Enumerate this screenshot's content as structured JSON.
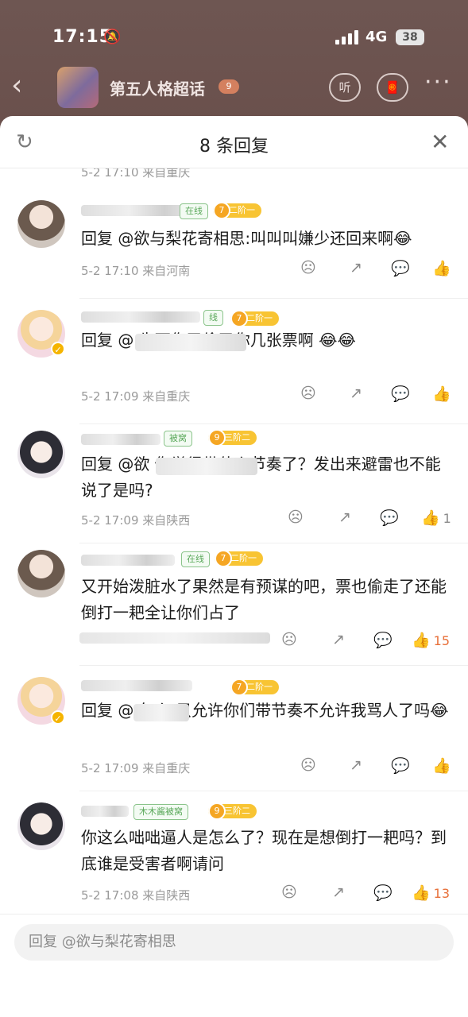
{
  "status": {
    "time": "17:15",
    "network": "4G",
    "battery": "38"
  },
  "nav": {
    "topic_title": "第五人格超话",
    "topic_badge": "9",
    "listen_label": "听"
  },
  "sheet": {
    "title": "8 条回复"
  },
  "partial_meta": "5-2 17:10 来自重庆",
  "comments": [
    {
      "online": "在线",
      "level_num": "7",
      "level": "二阶一",
      "body": "回复 @欲与梨花寄相思:叫叫叫嫌少还回来啊😂",
      "meta": "5-2 17:10 来自河南",
      "likes": ""
    },
    {
      "online": "线",
      "level_num": "7",
      "level": "二阶一",
      "body": "回复 @ 先死你了偷了你几张票啊 😂😂",
      "meta": "5-2 17:09 来自重庆",
      "likes": ""
    },
    {
      "online": "被窝",
      "level_num": "9",
      "level": "三阶二",
      "body": "回复 @欲 你觉得带什么节奏了？发出来避雷也不能说了是吗?",
      "meta": "5-2 17:09 来自陕西",
      "likes": "1"
    },
    {
      "online": "在线",
      "level_num": "7",
      "level": "二阶一",
      "body": "又开始泼脏水了果然是有预谋的吧，票也偷走了还能倒打一耙全让你们占了",
      "meta": "",
      "likes": "15"
    },
    {
      "online": "",
      "level_num": "7",
      "level": "二阶一",
      "body": "回复 @ 怎么 只允许你们带节奏不允许我骂人了吗😂",
      "meta": "5-2 17:09 来自重庆",
      "likes": ""
    },
    {
      "online": "木木酱被窝",
      "level_num": "9",
      "level": "三阶二",
      "body": "你这么咄咄逼人是怎么了？现在是想倒打一耙吗？到底谁是受害者啊请问",
      "meta": "5-2 17:08 来自陕西",
      "likes": "13"
    }
  ],
  "reply": {
    "placeholder": "回复 @欲与梨花寄相思"
  },
  "colors": {
    "accent_like": "#e8703a",
    "level_badge": "#f8c433",
    "online_green": "#5aa85a"
  }
}
